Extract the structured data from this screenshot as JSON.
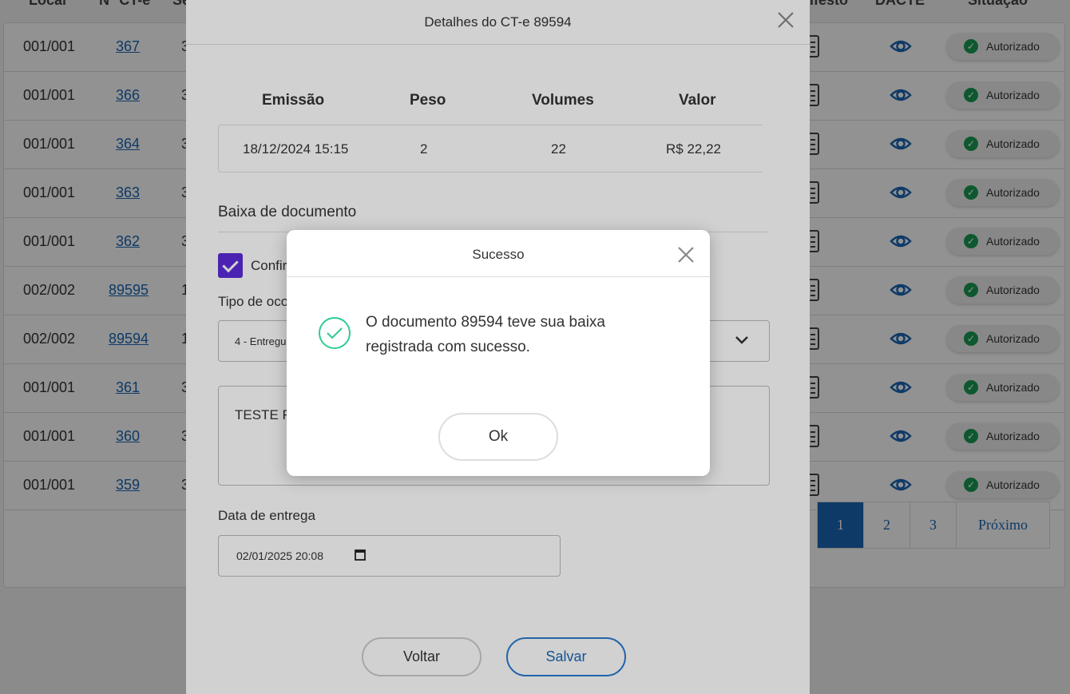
{
  "table": {
    "headers": [
      "Local",
      "N° CT-e",
      "Se",
      "Manifesto",
      "DACTE",
      "Situação"
    ],
    "rows": [
      {
        "local": "001/001",
        "numero": "367",
        "serie": "3",
        "situacao": "Autorizado"
      },
      {
        "local": "001/001",
        "numero": "366",
        "serie": "3",
        "situacao": "Autorizado"
      },
      {
        "local": "001/001",
        "numero": "364",
        "serie": "3",
        "situacao": "Autorizado"
      },
      {
        "local": "001/001",
        "numero": "363",
        "serie": "3",
        "situacao": "Autorizado"
      },
      {
        "local": "001/001",
        "numero": "362",
        "serie": "3",
        "situacao": "Autorizado"
      },
      {
        "local": "002/002",
        "numero": "89595",
        "serie": "1",
        "situacao": "Autorizado"
      },
      {
        "local": "002/002",
        "numero": "89594",
        "serie": "1",
        "situacao": "Autorizado"
      },
      {
        "local": "001/001",
        "numero": "361",
        "serie": "3",
        "situacao": "Autorizado"
      },
      {
        "local": "001/001",
        "numero": "360",
        "serie": "3",
        "situacao": "Autorizado"
      },
      {
        "local": "001/001",
        "numero": "359",
        "serie": "3",
        "situacao": "Autorizado"
      }
    ]
  },
  "pagination": {
    "pages": [
      "1",
      "2",
      "3"
    ],
    "active": "1",
    "next_label": "Próximo"
  },
  "details_modal": {
    "title": "Detalhes do CT-e 89594",
    "summary_headers": [
      "Emissão",
      "Peso",
      "Volumes",
      "Valor"
    ],
    "summary_values": [
      "18/12/2024 15:15",
      "2",
      "22",
      "R$ 22,22"
    ],
    "section_title": "Baixa de documento",
    "checkbox_label": "Confir",
    "tipo_label": "Tipo de oco",
    "tipo_value": "4 - Entregu",
    "obs_value": "TESTE R",
    "date_label": "Data de entrega",
    "date_value": "02/01/2025 20:08",
    "back_label": "Voltar",
    "save_label": "Salvar"
  },
  "success_modal": {
    "title": "Sucesso",
    "message": "O documento 89594 teve sua baixa registrada com sucesso.",
    "ok_label": "Ok"
  },
  "colors": {
    "accent": "#1a66b5",
    "success": "#1a9b54",
    "check_purple": "#5b2bd9",
    "success_icon": "#2ecc8f"
  },
  "icons": {
    "close": "close-icon",
    "eye": "eye-icon",
    "manifest": "document-icon",
    "check": "check-circle-icon",
    "chevron": "chevron-down-icon",
    "calendar": "calendar-icon"
  }
}
